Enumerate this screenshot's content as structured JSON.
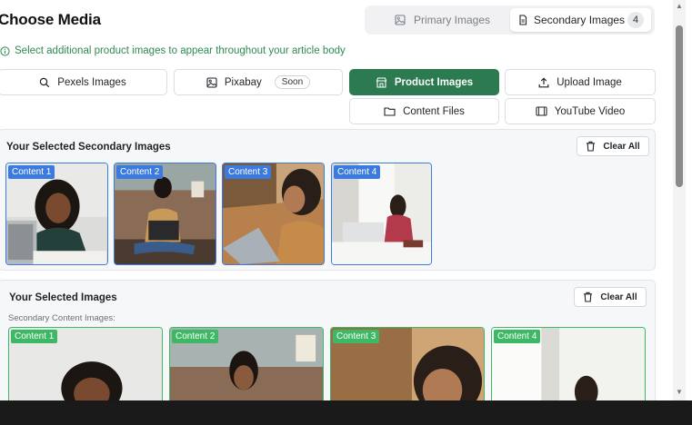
{
  "header": {
    "title": "Choose Media",
    "tabs": [
      {
        "label": "Primary Images",
        "icon": "image-icon"
      },
      {
        "label": "Secondary Images",
        "icon": "document-icon",
        "count": "4"
      }
    ]
  },
  "info_text": "Select additional product images to appear throughout your article body",
  "sources": {
    "pexels": "Pexels Images",
    "pixabay": "Pixabay",
    "pixabay_badge": "Soon",
    "product": "Product Images",
    "upload": "Upload Image",
    "content": "Content Files",
    "youtube": "YouTube Video"
  },
  "secondary_panel": {
    "title": "Your Selected Secondary Images",
    "clear_label": "Clear All",
    "items": [
      "Content 1",
      "Content 2",
      "Content 3",
      "Content 4"
    ]
  },
  "selected_panel": {
    "title": "Your Selected Images",
    "clear_label": "Clear All",
    "sub_label": "Secondary Content Images:",
    "items": [
      "Content 1",
      "Content 2",
      "Content 3",
      "Content 4"
    ]
  },
  "colors": {
    "accent": "#2b7a50",
    "info": "#2f8a52",
    "tag_blue": "#3b7be0",
    "tag_green": "#3fb866"
  }
}
